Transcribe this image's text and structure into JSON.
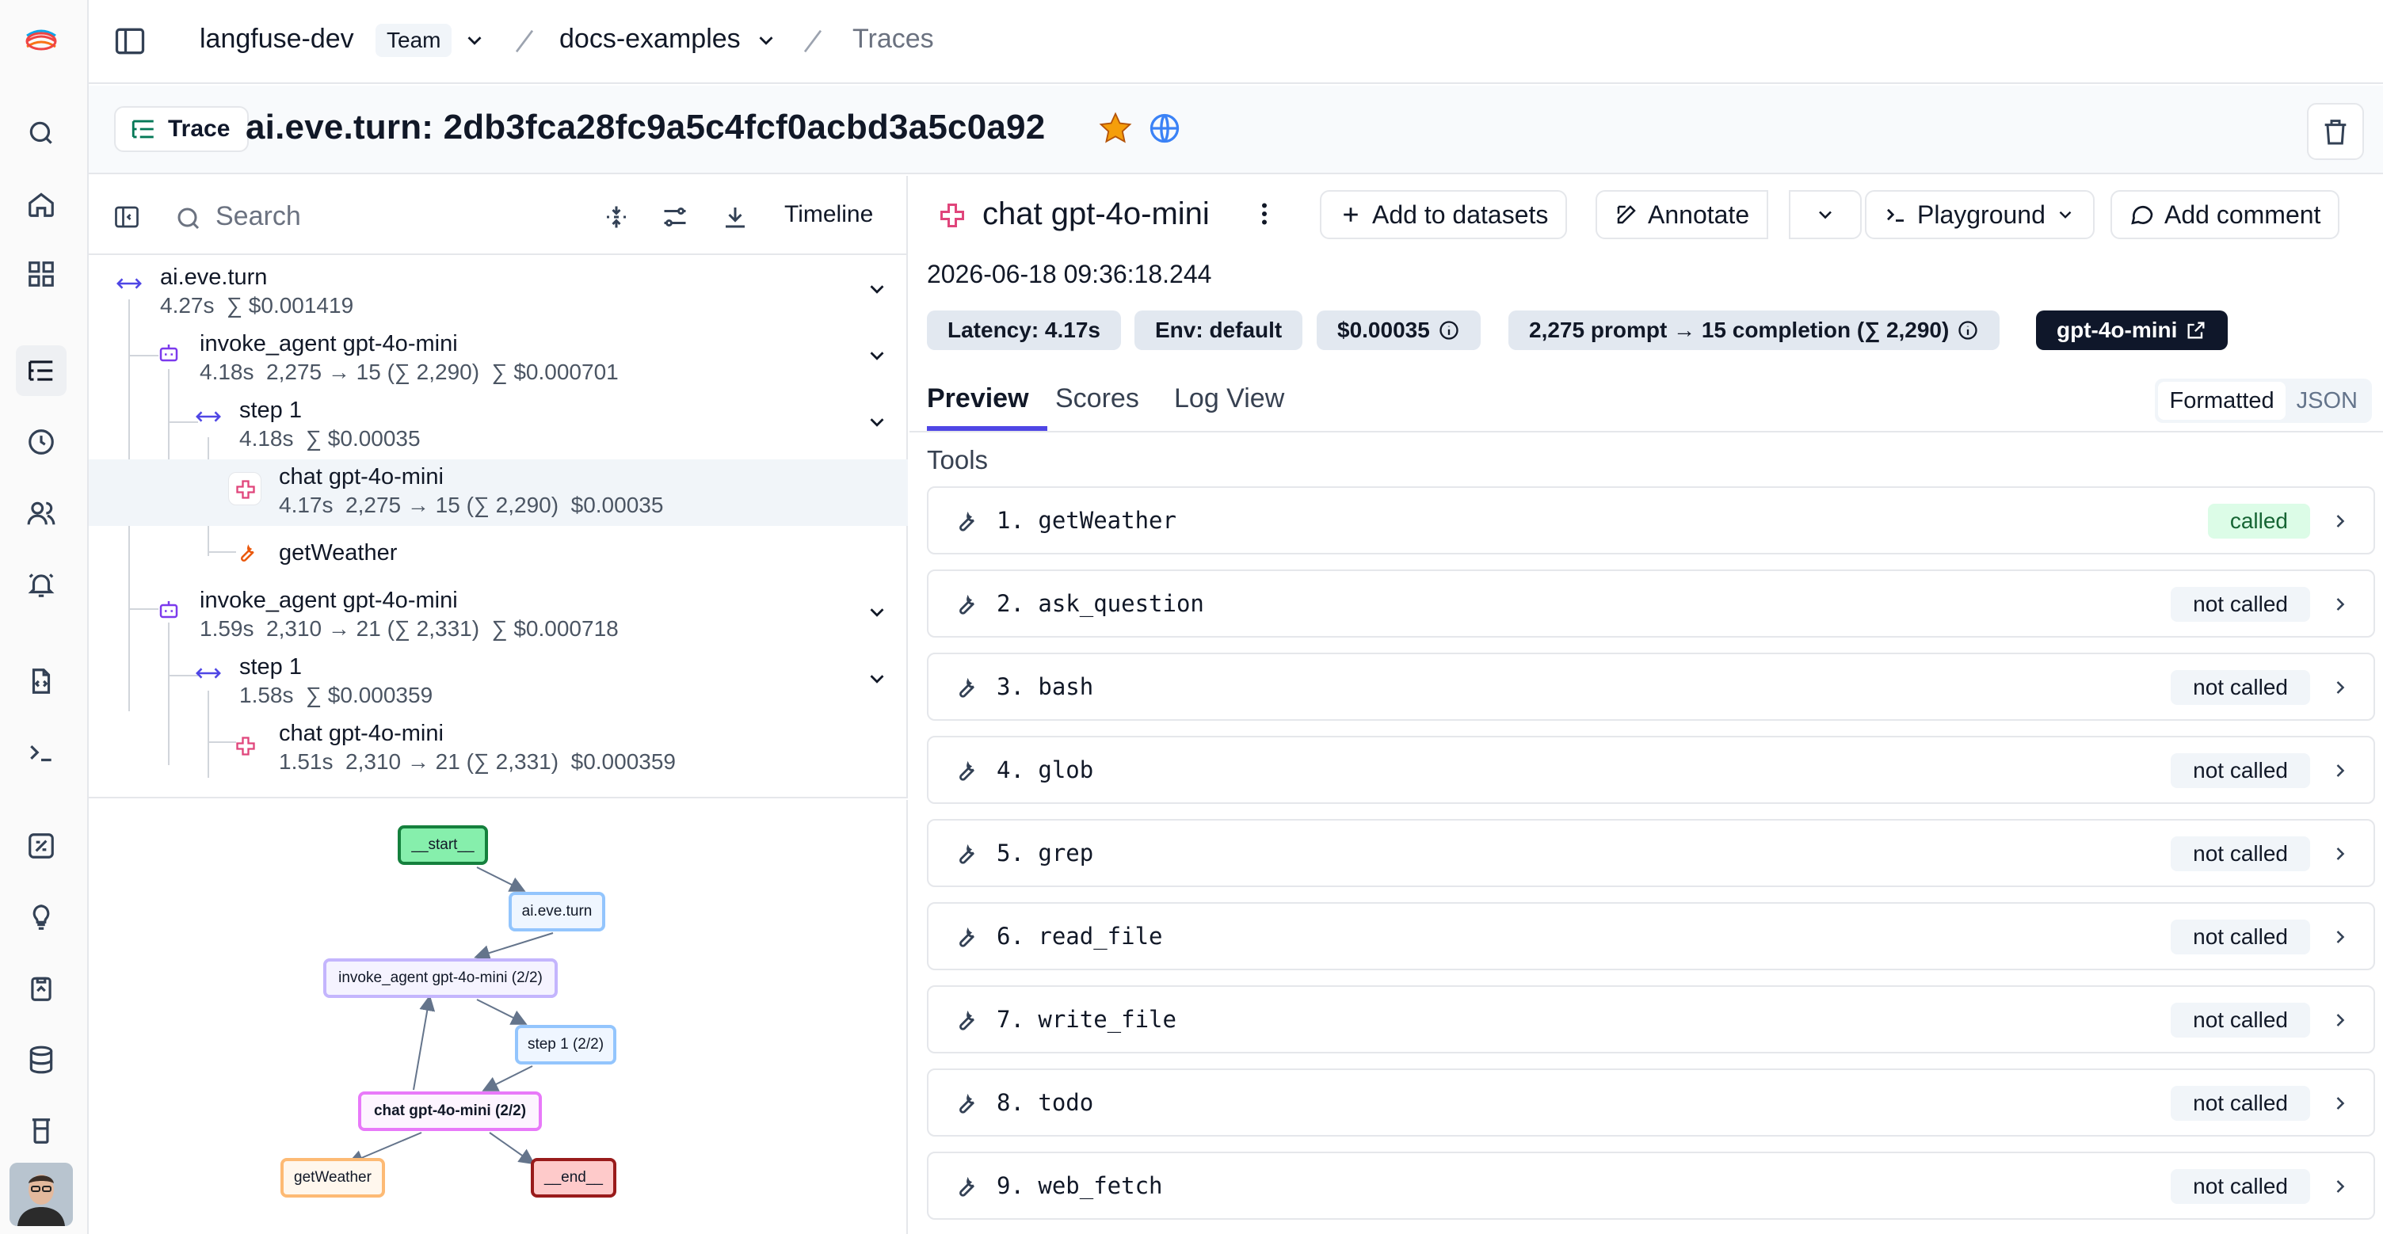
{
  "breadcrumb": {
    "org": "langfuse-dev",
    "team_badge": "Team",
    "project": "docs-examples",
    "page": "Traces"
  },
  "trace": {
    "chip_label": "Trace",
    "title": "ai.eve.turn: 2db3fca28fc9a5c4fcf0acbd3a5c0a92"
  },
  "tree_toolbar": {
    "search_placeholder": "Search",
    "timeline_label": "Timeline"
  },
  "tree": [
    {
      "name": "ai.eve.turn",
      "meta": "4.27s  ∑ $0.001419"
    },
    {
      "name": "invoke_agent gpt-4o-mini",
      "meta": "4.18s  2,275 → 15 (∑ 2,290)  ∑ $0.000701"
    },
    {
      "name": "step 1",
      "meta": "4.18s  ∑ $0.00035"
    },
    {
      "name": "chat gpt-4o-mini",
      "meta": "4.17s  2,275 → 15 (∑ 2,290)  $0.00035"
    },
    {
      "name": "getWeather",
      "meta": ""
    },
    {
      "name": "invoke_agent gpt-4o-mini",
      "meta": "1.59s  2,310 → 21 (∑ 2,331)  ∑ $0.000718"
    },
    {
      "name": "step 1",
      "meta": "1.58s  ∑ $0.000359"
    },
    {
      "name": "chat gpt-4o-mini",
      "meta": "1.51s  2,310 → 21 (∑ 2,331)  $0.000359"
    }
  ],
  "graph": {
    "start": "__start__",
    "turn": "ai.eve.turn",
    "agent": "invoke_agent gpt-4o-mini (2/2)",
    "step": "step 1 (2/2)",
    "chat": "chat gpt-4o-mini (2/2)",
    "tool": "getWeather",
    "end": "__end__"
  },
  "detail": {
    "title": "chat gpt-4o-mini",
    "add_to_datasets": "Add to datasets",
    "annotate": "Annotate",
    "playground": "Playground",
    "add_comment": "Add comment",
    "timestamp": "2026-06-18 09:36:18.244",
    "pills": {
      "latency": "Latency: 4.17s",
      "env": "Env: default",
      "cost": "$0.00035",
      "tokens": "2,275 prompt → 15 completion (∑ 2,290)",
      "model": "gpt-4o-mini"
    },
    "tabs": [
      "Preview",
      "Scores",
      "Log View"
    ],
    "view_formatted": "Formatted",
    "view_json": "JSON",
    "section": "Tools"
  },
  "tools": [
    {
      "name": "1. getWeather",
      "status": "called"
    },
    {
      "name": "2. ask_question",
      "status": "not called"
    },
    {
      "name": "3. bash",
      "status": "not called"
    },
    {
      "name": "4. glob",
      "status": "not called"
    },
    {
      "name": "5. grep",
      "status": "not called"
    },
    {
      "name": "6. read_file",
      "status": "not called"
    },
    {
      "name": "7. write_file",
      "status": "not called"
    },
    {
      "name": "8. todo",
      "status": "not called"
    },
    {
      "name": "9. web_fetch",
      "status": "not called"
    }
  ],
  "colors": {
    "accent": "#4f46e5",
    "star": "#f59e0b",
    "globe": "#3b82f6",
    "called_bg": "#dcfce7",
    "called_text": "#166534",
    "generation_icon": "#e0457b",
    "agent_icon": "#7c3aed",
    "span_icon": "#4f46e5",
    "tool_icon": "#ea580c"
  }
}
